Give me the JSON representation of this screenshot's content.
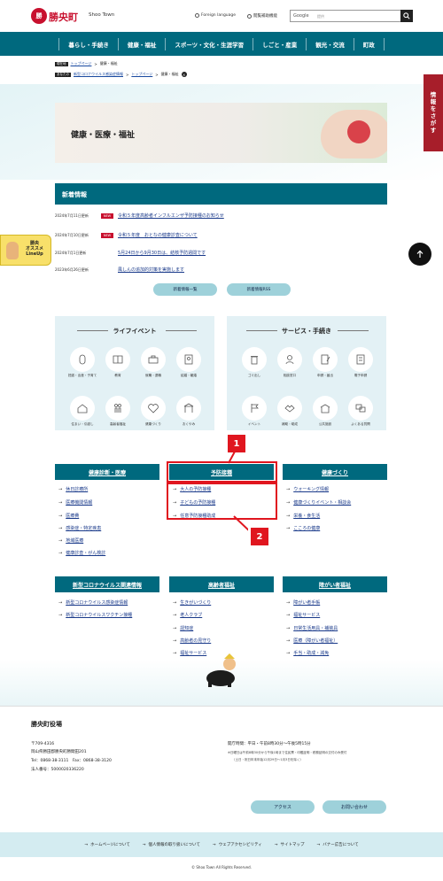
{
  "header": {
    "logo_mark": "勝",
    "logo_text": "勝央町",
    "logo_sub": "Shoo Town",
    "foreign_language": "Foreign language",
    "reading_aid": "閲覧補助機能",
    "search_label": "Google",
    "search_placeholder": "提供"
  },
  "gnav": [
    "暮らし・手続き",
    "健康・福祉",
    "スポーツ・文化・生涯学習",
    "しごと・産業",
    "観光・交流",
    "町政"
  ],
  "breadcrumb": {
    "row1_tag": "現在地",
    "row1": [
      "トップページ",
      "健康・福祉"
    ],
    "row2_tag": "あなたの",
    "row2": [
      "新型コロナウイルス感染症情報",
      "トップページ",
      "健康・福祉"
    ]
  },
  "hero": {
    "title": "健康・医療・福祉"
  },
  "side_tab": [
    "情",
    "報",
    "を",
    "さ",
    "が",
    "す"
  ],
  "news": {
    "heading": "新着情報",
    "items": [
      {
        "date": "2024年7月11日更新",
        "badge": "NEW",
        "text": "令和５年度高齢者インフルエンザ予防接種のお知らせ"
      },
      {
        "date": "2024年7月10日更新",
        "badge": "NEW",
        "text": "令和５年度　おとなの健康診査について"
      },
      {
        "date": "2024年7月1日更新",
        "badge": "",
        "text": "5月24日から9月30日は、結核予防週間です"
      },
      {
        "date": "2023年6月26日更新",
        "badge": "",
        "text": "風しんの追加的対策を実施します"
      }
    ],
    "btn_list": "新着情報一覧",
    "btn_rss": "新着情報RSS"
  },
  "float_badge": {
    "line1": "勝央",
    "line2": "オススメ",
    "line3": "LineUp"
  },
  "life_events": {
    "title": "ライフイベント",
    "items": [
      "妊娠・出産・子育て",
      "教育",
      "就職・退職",
      "結婚・離婚",
      "住まい・引越し",
      "高齢者福祉",
      "健康づくり",
      "おくやみ"
    ]
  },
  "services": {
    "title": "サービス・手続き",
    "items": [
      "ゴミ出し",
      "相談窓口",
      "申請・届出",
      "電子申請",
      "イベント",
      "補助・助成",
      "公共施設",
      "よくある質問"
    ]
  },
  "categories": [
    {
      "title": "健康診断・医療",
      "items": [
        "休日診療所",
        "医療機関情報",
        "医療費",
        "感染症・特定疾患",
        "地域医療",
        "健康診査・がん検診"
      ]
    },
    {
      "title": "予防接種",
      "items": [
        "大人の予防接種",
        "子どもの予防接種",
        "任意予防接種助成"
      ]
    },
    {
      "title": "健康づくり",
      "items": [
        "ウォーキング情報",
        "健康づくりイベント・相談会",
        "栄養・食生活",
        "こころの健康"
      ]
    },
    {
      "title": "新型コロナウイルス関連情報",
      "items": [
        "新型コロナウイルス感染症情報",
        "新型コロナウイルスワクチン接種"
      ]
    },
    {
      "title": "高齢者福祉",
      "items": [
        "生きがいづくり",
        "老人クラブ",
        "認知症",
        "高齢者の見守り",
        "福祉サービス"
      ]
    },
    {
      "title": "障がい者福祉",
      "items": [
        "障がい者手帳",
        "福祉サービス",
        "日常生活用具・補装具",
        "医療（障がい者福祉）",
        "手当・助成・減免"
      ]
    }
  ],
  "markers": [
    "1",
    "2"
  ],
  "footer": {
    "title": "勝央町役場",
    "zip": "〒709-4316",
    "address": "岡山県勝田郡勝央町勝間田201",
    "tel": "Tel：0868-38-3111　Fax：0868-38-3120",
    "corp": "法人番号：5000020336220",
    "hours": "開庁時間：平日・午前8時30分～午後5時15分",
    "note1": "※日曜日は午前8時30分から午後1時まで住民票・印鑑証明・税務証明の交付のみ受付",
    "note2": "（土日・祝日年末年始12月29日～1月3日を除く）",
    "btn_access": "アクセス",
    "btn_contact": "お問い合わせ"
  },
  "bottom_links": [
    "ホームページについて",
    "個人情報の取り扱いについて",
    "ウェブアクセシビリティ",
    "サイトマップ",
    "バナー広告について"
  ],
  "copyright": "© Shoo Town All Rights Reserved."
}
